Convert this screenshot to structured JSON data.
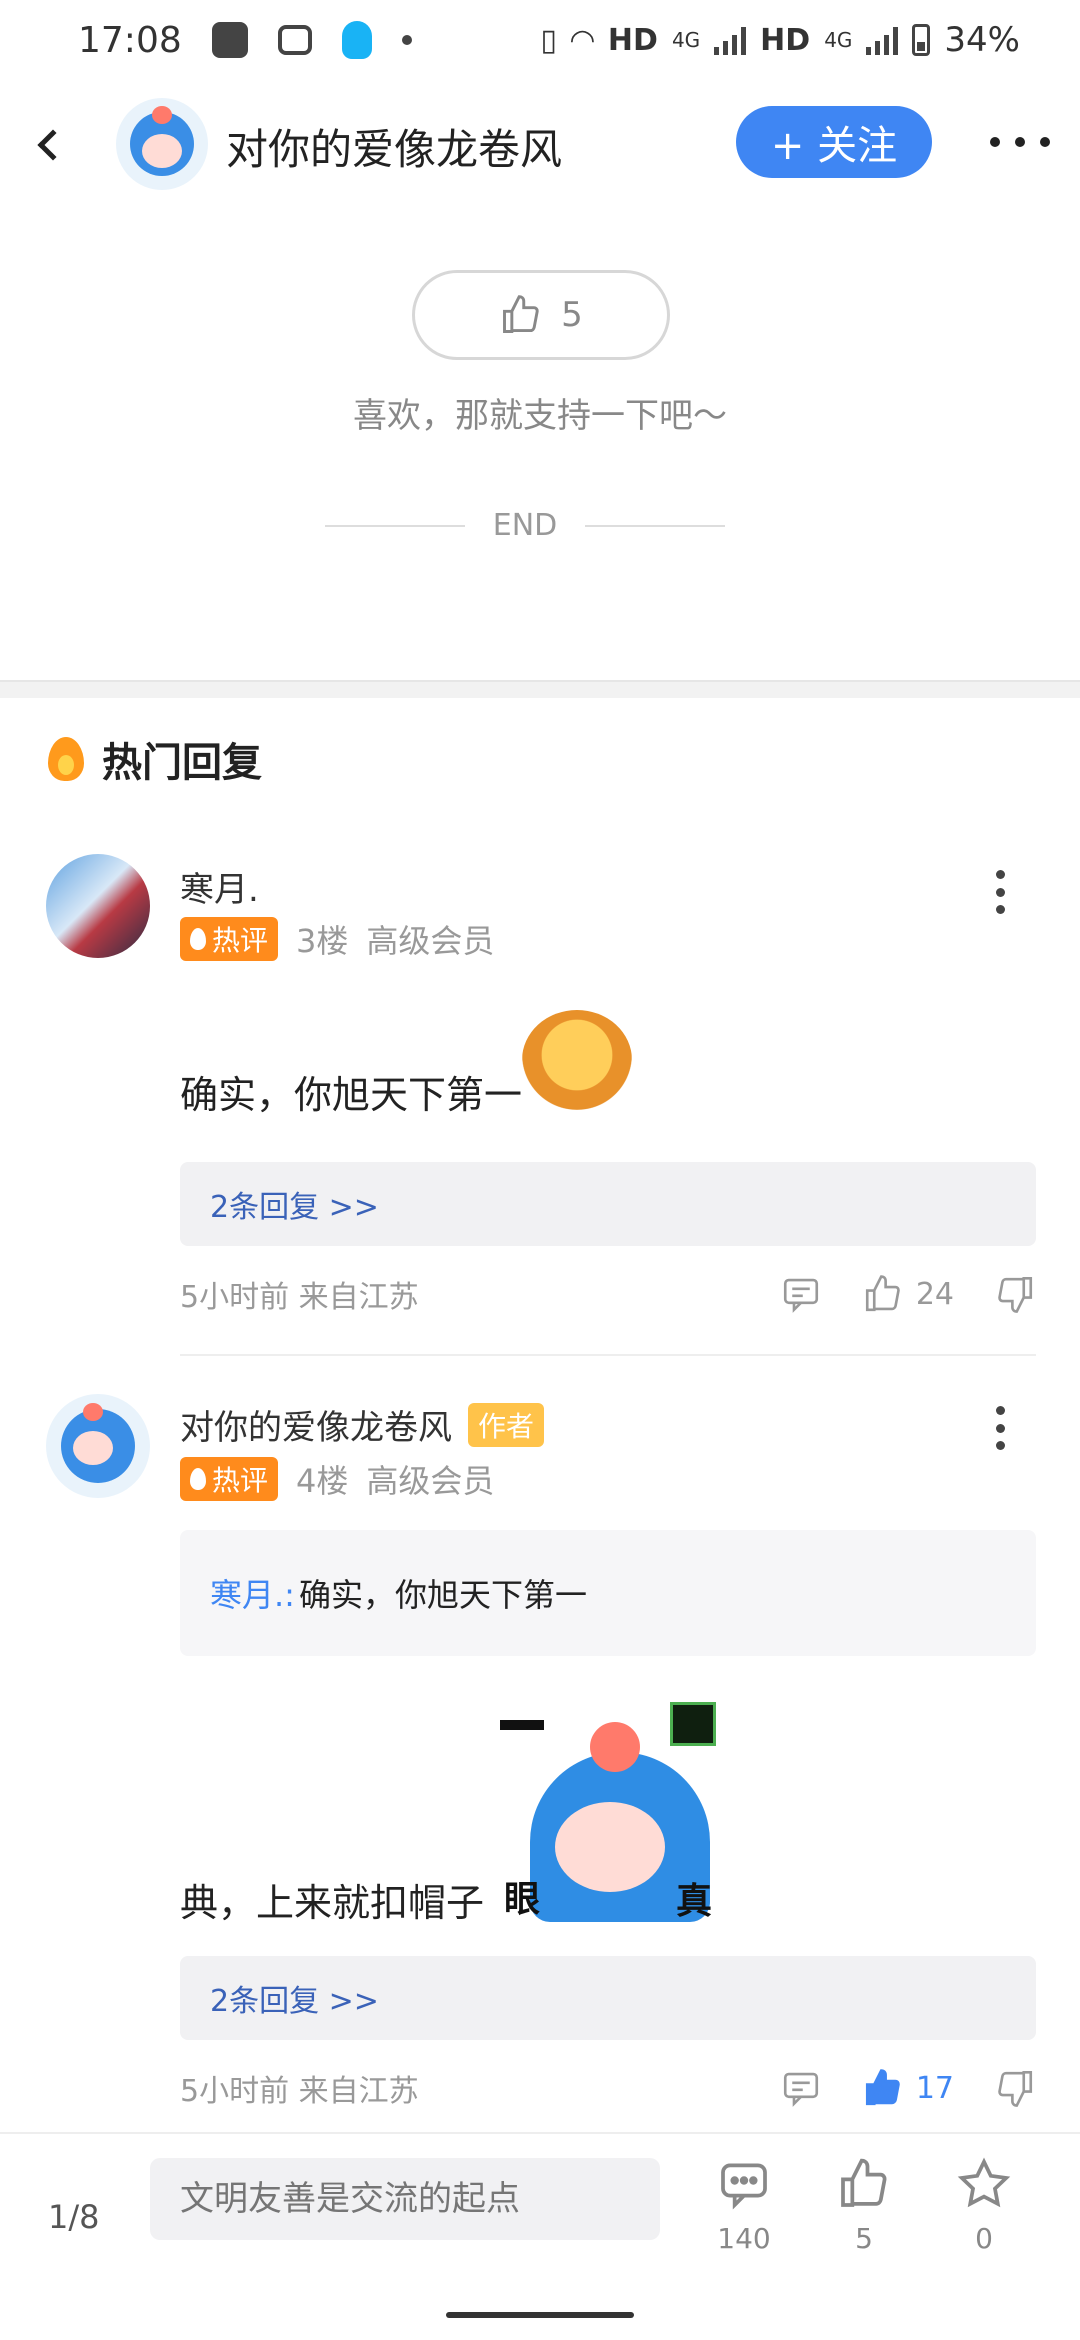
{
  "status_bar": {
    "time": "17:08",
    "net1": "HD",
    "net1_type": "4G",
    "net2": "HD",
    "net2_type": "4G",
    "battery": "34%"
  },
  "header": {
    "title": "对你的爱像龙卷风",
    "follow_label": "+ 关注"
  },
  "like_section": {
    "count": "5",
    "hint": "喜欢，那就支持一下吧～",
    "end_label": "END"
  },
  "hot_replies": {
    "title": "热门回复",
    "comments": [
      {
        "name": "寒月.",
        "badge": "热评",
        "floor": "3楼",
        "level": "高级会员",
        "text": "确实，你旭天下第一",
        "replies_link": "2条回复 >>",
        "time": "5小时前 来自江苏",
        "likes": "24"
      },
      {
        "name": "对你的爱像龙卷风",
        "author_tag": "作者",
        "badge": "热评",
        "floor": "4楼",
        "level": "高级会员",
        "quote_name": "寒月.:",
        "quote_text": "确实，你旭天下第一",
        "text": "典，上来就扣帽子",
        "sticker_left": "眼",
        "sticker_right": "真",
        "replies_link": "2条回复 >>",
        "time": "5小时前 来自江苏",
        "likes": "17"
      }
    ]
  },
  "bottom_bar": {
    "page_indicator": "1/8",
    "input_placeholder": "文明友善是交流的起点",
    "comments_count": "140",
    "likes_count": "5",
    "favorites_count": "0"
  },
  "colors": {
    "accent": "#3f86f3",
    "hot_badge": "#ff8b1c",
    "author_tag": "#ffc34a",
    "reply_link": "#3a62b8"
  }
}
